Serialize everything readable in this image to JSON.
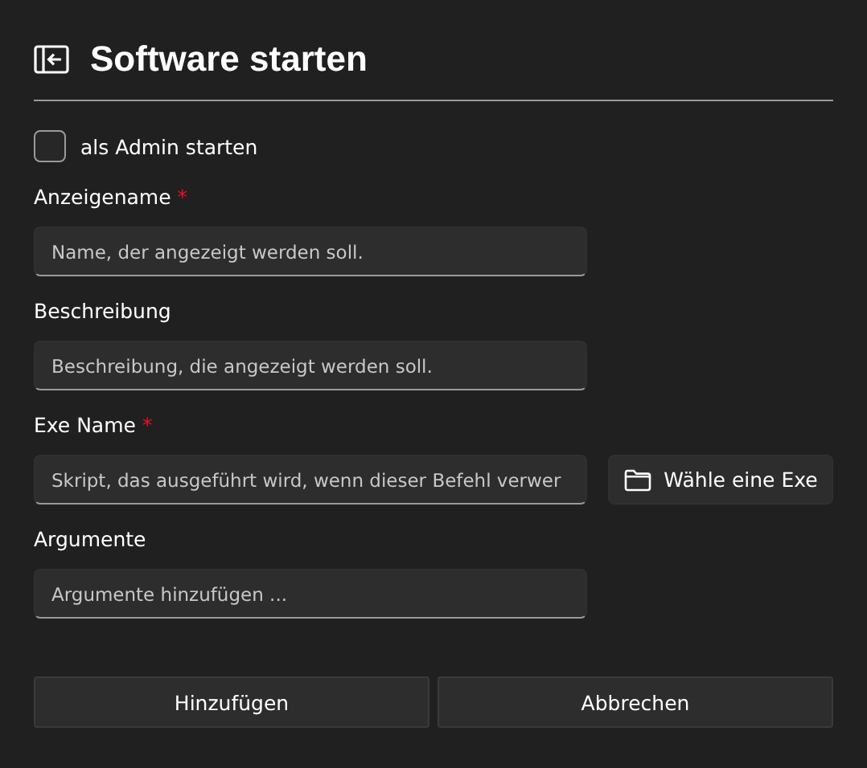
{
  "title": "Software starten",
  "admin_checkbox": {
    "label": "als Admin starten",
    "checked": false
  },
  "fields": [
    {
      "kind": "text",
      "label": "Anzeigename",
      "required": true,
      "placeholder": "Name, der angezeigt werden soll."
    },
    {
      "kind": "text",
      "label": "Beschreibung",
      "required": false,
      "placeholder": "Beschreibung, die angezeigt werden soll."
    },
    {
      "kind": "file",
      "label": "Exe Name",
      "required": true,
      "placeholder": "Skript, das ausgeführt wird, wenn dieser Befehl verwer",
      "button": "Wähle eine Exe"
    },
    {
      "kind": "text",
      "label": "Argumente",
      "required": false,
      "placeholder": "Argumente hinzufügen ..."
    }
  ],
  "required_mark": "*",
  "buttons": [
    "Hinzufügen",
    "Abbrechen"
  ]
}
